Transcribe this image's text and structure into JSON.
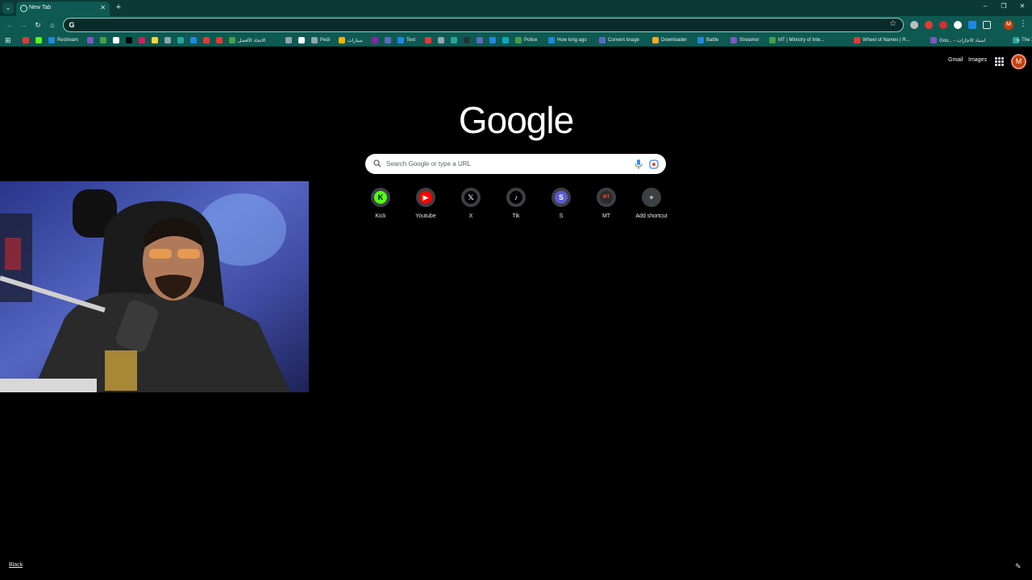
{
  "tab": {
    "title": "New Tab"
  },
  "window": {
    "minimize_glyph": "–",
    "restore_glyph": "❐",
    "close_glyph": "✕"
  },
  "toolbar": {
    "omnibox_value": ""
  },
  "bookmarks": [
    {
      "label": "",
      "color": "#e53935"
    },
    {
      "label": "",
      "color": "#53fc18"
    },
    {
      "label": "Restream",
      "color": "#1e88e5"
    },
    {
      "label": "",
      "color": "#7e57c2"
    },
    {
      "label": "",
      "color": "#43a047"
    },
    {
      "label": "",
      "color": "#ffffff"
    },
    {
      "label": "",
      "color": "#000000"
    },
    {
      "label": "",
      "color": "#d81b60"
    },
    {
      "label": "",
      "color": "#fdd835"
    },
    {
      "label": "",
      "color": "#90a4ae"
    },
    {
      "label": "",
      "color": "#26a69a"
    },
    {
      "label": "",
      "color": "#1e88e5"
    },
    {
      "label": "",
      "color": "#e53935"
    },
    {
      "label": "",
      "color": "#e53935"
    },
    {
      "label": "الاتحاد الأفضل",
      "color": "#43a047"
    },
    {
      "label": "",
      "color": "#90a4ae"
    },
    {
      "label": "",
      "color": "#ffffff"
    },
    {
      "label": "Pedi",
      "color": "#90a4ae"
    },
    {
      "label": "سيارات",
      "color": "#ffb300"
    },
    {
      "label": "",
      "color": "#8e24aa"
    },
    {
      "label": "",
      "color": "#5c6bc0"
    },
    {
      "label": "Text",
      "color": "#1e88e5"
    },
    {
      "label": "",
      "color": "#e53935"
    },
    {
      "label": "",
      "color": "#90a4ae"
    },
    {
      "label": "",
      "color": "#26a69a"
    },
    {
      "label": "",
      "color": "#263238"
    },
    {
      "label": "",
      "color": "#5c6bc0"
    },
    {
      "label": "",
      "color": "#1e88e5"
    },
    {
      "label": "",
      "color": "#00acc1"
    },
    {
      "label": "Police",
      "color": "#43a047"
    },
    {
      "label": "How long ago",
      "color": "#1e88e5"
    },
    {
      "label": "Convert image",
      "color": "#5c6bc0"
    },
    {
      "label": "Downloader",
      "color": "#f9a825"
    },
    {
      "label": "Battle",
      "color": "#1e88e5"
    },
    {
      "label": "Streamer",
      "color": "#7e57c2"
    },
    {
      "label": "MT | Ministry of Inte...",
      "color": "#43a047"
    },
    {
      "label": "Wheel of Names | R...",
      "color": "#e53935"
    },
    {
      "label": "Goo... - اسناد الاجازات",
      "color": "#7e57c2"
    },
    {
      "label": "The X Picker",
      "color": "#26a69a"
    }
  ],
  "header_links": {
    "gmail": "Gmail",
    "images": "Images"
  },
  "profile": {
    "initial": "M",
    "color": "#c2410c"
  },
  "logo": {
    "text": "Google"
  },
  "search": {
    "placeholder": "Search Google or type a URL"
  },
  "shortcuts": [
    {
      "label": "Kick",
      "glyph": "K",
      "bg": "#53fc18",
      "fg": "#000000"
    },
    {
      "label": "Youtube",
      "glyph": "▶",
      "bg": "#ff0000",
      "fg": "#ffffff"
    },
    {
      "label": "X",
      "glyph": "𝕏",
      "bg": "#000000",
      "fg": "#ffffff"
    },
    {
      "label": "Tik",
      "glyph": "♪",
      "bg": "#000000",
      "fg": "#ffffff"
    },
    {
      "label": "S",
      "glyph": "S",
      "bg": "#5b5bd6",
      "fg": "#ffffff"
    },
    {
      "label": "MT",
      "glyph": "MT",
      "bg": "#2b2b2b",
      "fg": "#ff3b30"
    },
    {
      "label": "Add shortcut",
      "glyph": "+",
      "bg": "#3c4043",
      "fg": "#e8eaed"
    }
  ],
  "footer": {
    "customize_link": "Black"
  }
}
